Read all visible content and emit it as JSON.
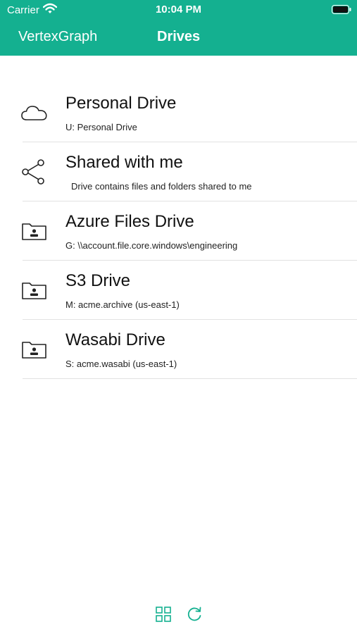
{
  "status_bar": {
    "carrier": "Carrier",
    "time": "10:04 PM",
    "icons": [
      "wifi-icon",
      "battery-icon"
    ]
  },
  "nav": {
    "app_name": "VertexGraph",
    "title": "Drives"
  },
  "drives": [
    {
      "name": "Personal Drive",
      "detail": "U:  Personal Drive",
      "icon": "cloud-icon"
    },
    {
      "name": "Shared with me",
      "detail": "Drive contains files and folders shared to me",
      "icon": "share-icon"
    },
    {
      "name": "Azure Files Drive",
      "detail": "G:  \\\\account.file.core.windows\\engineering",
      "icon": "folder-user-icon"
    },
    {
      "name": "S3 Drive",
      "detail": "M:  acme.archive (us-east-1)",
      "icon": "folder-user-icon"
    },
    {
      "name": "Wasabi Drive",
      "detail": "S:  acme.wasabi (us-east-1)",
      "icon": "folder-user-icon"
    }
  ],
  "toolbar": {
    "icons": [
      "grid-view-icon",
      "refresh-icon"
    ]
  },
  "colors": {
    "header_bg": "#14b090",
    "accent": "#14b090",
    "text": "#111111"
  }
}
